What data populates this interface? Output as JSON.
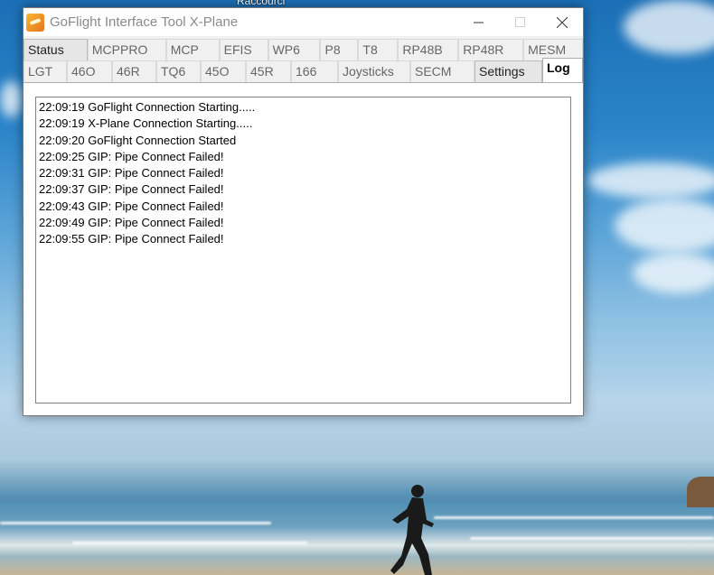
{
  "desktop": {
    "top_label": "Raccourci"
  },
  "window": {
    "title": "GoFlight Interface Tool X-Plane",
    "icons": {
      "app": "goflight-logo-icon",
      "minimize": "minimize-icon",
      "maximize": "maximize-icon",
      "close": "close-icon"
    }
  },
  "tabs": {
    "row1": [
      "Status",
      "MCPPRO",
      "MCP",
      "EFIS",
      "WP6",
      "P8",
      "T8",
      "RP48B",
      "RP48R",
      "MESM"
    ],
    "row2": [
      "LGT",
      "46O",
      "46R",
      "TQ6",
      "45O",
      "45R",
      "166",
      "Joysticks",
      "SECM",
      "Settings",
      "Log"
    ],
    "active": "Log"
  },
  "log": {
    "lines": [
      "22:09:19 GoFlight Connection Starting.....",
      "22:09:19 X-Plane Connection Starting.....",
      "22:09:20 GoFlight Connection Started",
      "22:09:25 GIP: Pipe Connect Failed!",
      "22:09:31 GIP: Pipe Connect Failed!",
      "22:09:37 GIP: Pipe Connect Failed!",
      "22:09:43 GIP: Pipe Connect Failed!",
      "22:09:49 GIP: Pipe Connect Failed!",
      "22:09:55 GIP: Pipe Connect Failed!"
    ]
  }
}
